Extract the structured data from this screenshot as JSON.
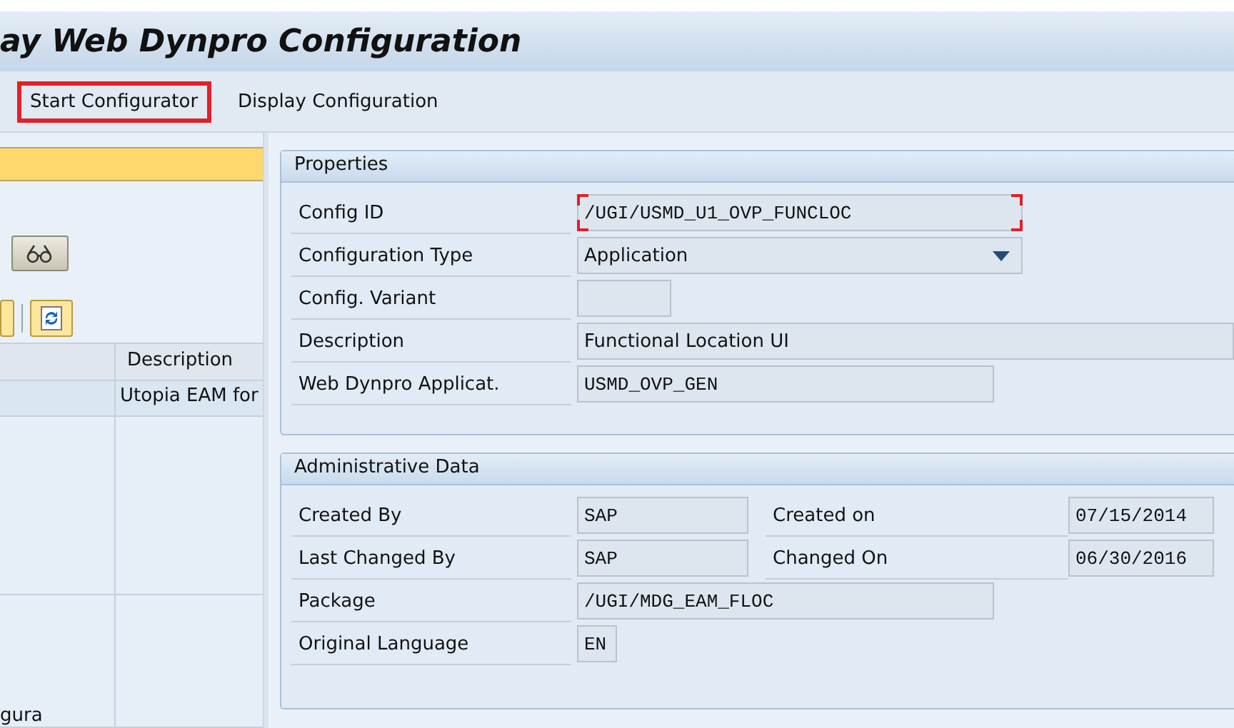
{
  "window": {
    "title": "ay Web Dynpro Configuration"
  },
  "toolbar": {
    "buttons": [
      {
        "label": "Start Configurator",
        "highlighted": true
      },
      {
        "label": "Display Configuration",
        "highlighted": false
      }
    ]
  },
  "left_pane": {
    "table": {
      "columns": [
        {
          "label": "Description"
        }
      ],
      "rows": [
        {
          "selected": true,
          "description": "Utopia EAM for"
        },
        {
          "selected": false
        },
        {
          "selected": false,
          "column_1": "gura"
        }
      ]
    }
  },
  "properties": {
    "title": "Properties",
    "rows": [
      {
        "label": "Config ID",
        "kind": "code",
        "value": "/UGI/USMD_U1_OVP_FUNCLOC",
        "focused": true
      },
      {
        "label": "Configuration Type",
        "kind": "dropdown",
        "value": "Application",
        "focused": false
      },
      {
        "label": "Config. Variant",
        "kind": "code",
        "focused": false
      },
      {
        "label": "Description",
        "kind": "text",
        "value": "Functional Location UI",
        "focused": false
      },
      {
        "label": "Web Dynpro Applicat.",
        "kind": "code",
        "value": "USMD_OVP_GEN",
        "focused": false
      }
    ]
  },
  "administrative_data": {
    "title": "Administrative Data",
    "rows": [
      {
        "label": "Created By",
        "value": "SAP",
        "label_2": "Created on",
        "value_2": "07/15/2014"
      },
      {
        "label": "Last Changed By",
        "value": "SAP",
        "label_2": "Changed On",
        "value_2": "06/30/2016"
      },
      {
        "label": "Package",
        "value": "/UGI/MDG_EAM_FLOC"
      },
      {
        "label": "Original Language",
        "value": "EN"
      }
    ]
  }
}
